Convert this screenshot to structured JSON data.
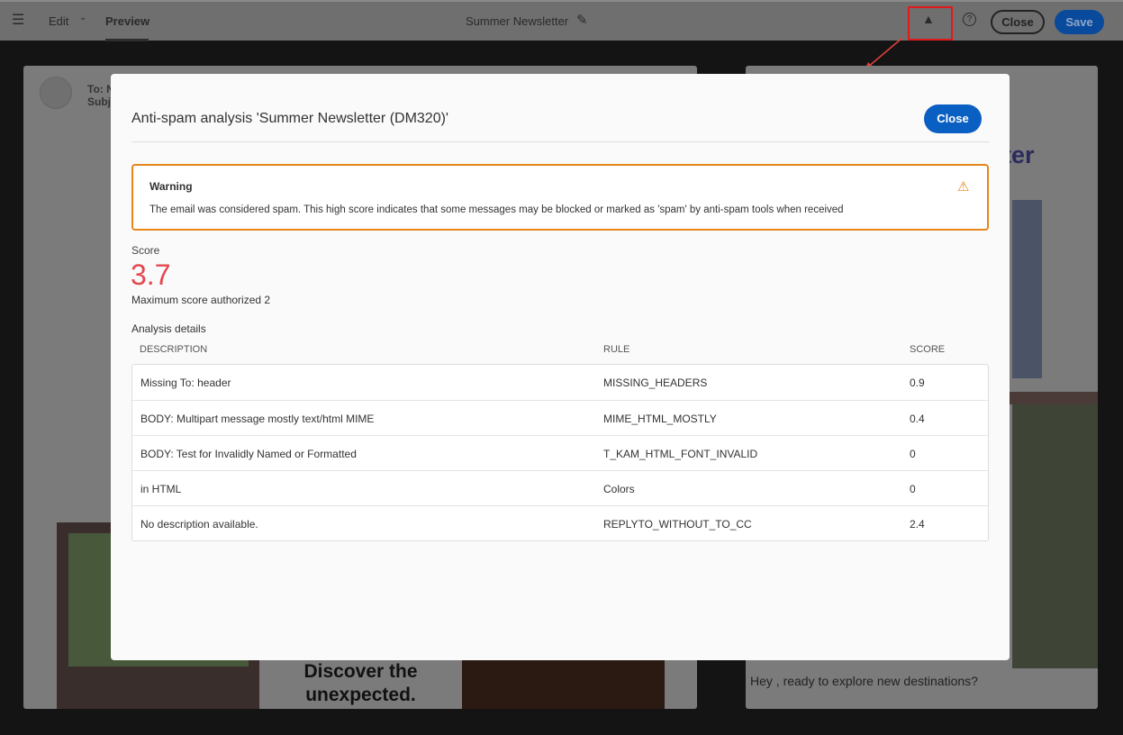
{
  "topbar": {
    "edit": "Edit",
    "preview": "Preview",
    "title": "Summer Newsletter",
    "close": "Close",
    "save": "Save"
  },
  "email": {
    "to": "To: N",
    "subject": "Subj",
    "headline_fragment": "ter",
    "cta_line1": "Discover the",
    "cta_line2": "unexpected.",
    "greeting": "Hey , ready to explore new destinations?"
  },
  "modal": {
    "title": "Anti-spam analysis 'Summer Newsletter (DM320)'",
    "close": "Close",
    "warning": {
      "title": "Warning",
      "text": "The email was considered spam. This high score indicates that some messages may be blocked or marked as 'spam' by anti-spam tools when received"
    },
    "score_label": "Score",
    "score": "3.7",
    "max_score": "Maximum score authorized 2",
    "details_label": "Analysis details",
    "columns": [
      "DESCRIPTION",
      "RULE",
      "SCORE"
    ],
    "rows": [
      {
        "description": "Missing To: header",
        "rule": "MISSING_HEADERS",
        "score": "0.9"
      },
      {
        "description": "BODY: Multipart message mostly text/html MIME",
        "rule": "MIME_HTML_MOSTLY",
        "score": "0.4"
      },
      {
        "description": "BODY: Test for Invalidly Named or Formatted",
        "rule": "T_KAM_HTML_FONT_INVALID",
        "score": "0"
      },
      {
        "description": "in HTML",
        "rule": "Colors",
        "score": "0"
      },
      {
        "description": "No description available.",
        "rule": "REPLYTO_WITHOUT_TO_CC",
        "score": "2.4"
      }
    ]
  },
  "colors": {
    "accent": "#0a5fc2",
    "warning": "#e68619",
    "score": "#e34850"
  }
}
